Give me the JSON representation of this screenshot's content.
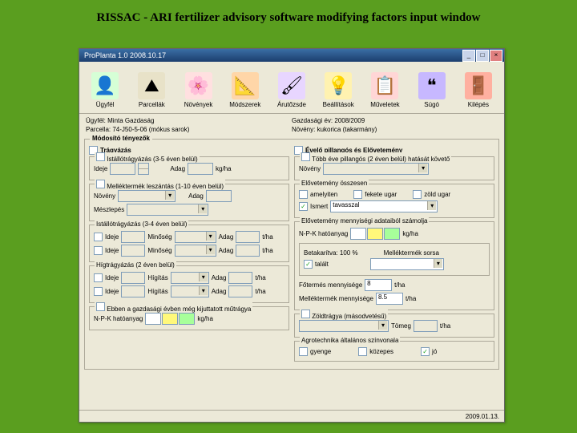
{
  "slide_title": "RISSAC - ARI fertilizer advisory software modifying factors input window",
  "window_title": "ProPlanta 1.0 2008.10.17",
  "toolbar": [
    {
      "label": "Ügyfél",
      "icon": "👤",
      "bg": "#d6ffd6"
    },
    {
      "label": "Parcellák",
      "icon": "⛰",
      "bg": "#e8e2c8"
    },
    {
      "label": "Növények",
      "icon": "🌸",
      "bg": "#ffe0e0"
    },
    {
      "label": "Módszerek",
      "icon": "📐",
      "bg": "#ffd6a8"
    },
    {
      "label": "Árutőzsde",
      "icon": "🖌",
      "bg": "#e8d6ff"
    },
    {
      "label": "Beállítások",
      "icon": "💡",
      "bg": "#fff2b0"
    },
    {
      "label": "Műveletek",
      "icon": "📋",
      "bg": "#ffd6d6"
    },
    {
      "label": "Súgó",
      "icon": "❝",
      "bg": "#c7b8ff"
    },
    {
      "label": "Kilépés",
      "icon": "🚪",
      "bg": "#ffb0a0"
    }
  ],
  "info": {
    "ugyfel_l": "Ügyfél:",
    "ugyfel_v": "Minta Gazdaság",
    "gazdev_l": "Gazdasági év:",
    "gazdev_v": "2008/2009",
    "parcella_l": "Parcella:",
    "parcella_v": "74-J50-5-06 (mókus sarok)",
    "noveny_l": "Növény:",
    "noveny_v": "kukorica (takarmány)"
  },
  "main_legend": "Módosító tényezők",
  "left": {
    "tragyazas": "Trágyázás",
    "ist1": {
      "legend": "Istállótrágyázás (3-5 éven belül)",
      "ideje": "Ideje",
      "adag": "Adag",
      "unit": "kg/ha"
    },
    "mell": {
      "legend": "Melléktermék leszántás (1-10 éven belül)",
      "nov": "Növény",
      "adag": "Adag",
      "mesz": "Mészlepés"
    },
    "ist2": {
      "legend": "Istállótrágyázás (3-4 éven belül)",
      "ideje": "Ideje",
      "min": "Minőség",
      "adag": "Adag",
      "unit": "t/ha"
    },
    "hig": {
      "legend": "Hígtrágyázás (2 éven belül)",
      "ideje": "Ideje",
      "hig": "Hígítás",
      "adag": "Adag",
      "unit": "t/ha"
    },
    "ebben": {
      "legend": "Ebben a gazdasági évben még kijuttatott műtrágya",
      "npk": "N-P-K hatóanyag",
      "unit": "kg/ha"
    }
  },
  "right": {
    "evelo": "Évelő pillangós és Elővetemény",
    "tobb": {
      "legend": "Több éve pillangós (2 éven belül) hatását követő",
      "nov": "Növény"
    },
    "elov": {
      "legend": "Elővetemény összesen",
      "amelyiten": "amelyiten",
      "tekete": "fekete ugar",
      "zold": "zöld ugar",
      "ismert": "Ismert",
      "val": "tavasszal"
    },
    "mell2": {
      "legend": "Elővetemény mennyiségi adataiból számolja",
      "npk": "N-P-K hatóanyag",
      "unit": "kg/ha",
      "betak": "Betakarítva: 100 %",
      "mellek": "Melléktermék sorsa",
      "felhaszn": "talált",
      "fo": "Főtermés mennyisége",
      "fo_v": "8",
      "fo_u": "t/ha",
      "mt": "Melléktermék mennyisége",
      "mt_v": "8.5",
      "mt_u": "t/ha"
    },
    "zold2": {
      "legend": "Zöldtrágya (másodvetésű)",
      "tor": "Tömeg",
      "unit": "t/ha"
    },
    "agro": {
      "legend": "Agrotechnika általános színvonala",
      "gy": "gyenge",
      "koz": "közepes",
      "jo": "jó"
    }
  },
  "status": "2009.01.13."
}
